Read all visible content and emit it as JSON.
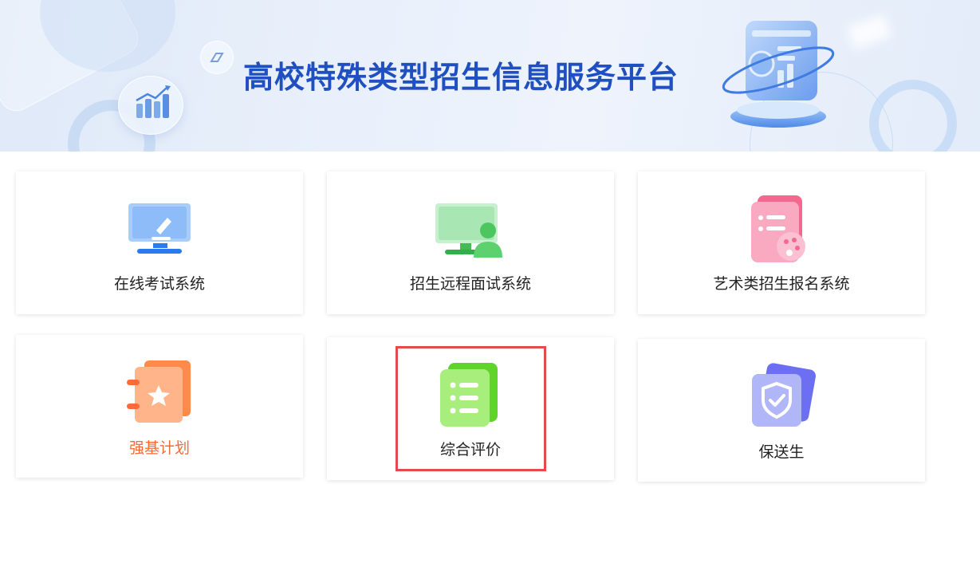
{
  "banner": {
    "title": "高校特殊类型招生信息服务平台"
  },
  "cards": [
    {
      "label": "在线考试系统",
      "icon": "monitor-pen-icon",
      "color": "#3b8af7"
    },
    {
      "label": "招生远程面试系统",
      "icon": "monitor-user-icon",
      "color": "#3fbf5a"
    },
    {
      "label": "艺术类招生报名系统",
      "icon": "list-palette-icon",
      "color": "#f25c8a"
    },
    {
      "label": "强基计划",
      "icon": "notebook-star-icon",
      "color": "#ff7a3d",
      "label_color": "#f36b3a"
    },
    {
      "label": "综合评价",
      "icon": "list-doc-icon",
      "color": "#6fd63a",
      "highlighted": true
    },
    {
      "label": "保送生",
      "icon": "shield-check-icon",
      "color": "#6a6ef0"
    }
  ],
  "colors": {
    "highlight_border": "#e5484d",
    "banner_title": "#1f4fc0"
  }
}
